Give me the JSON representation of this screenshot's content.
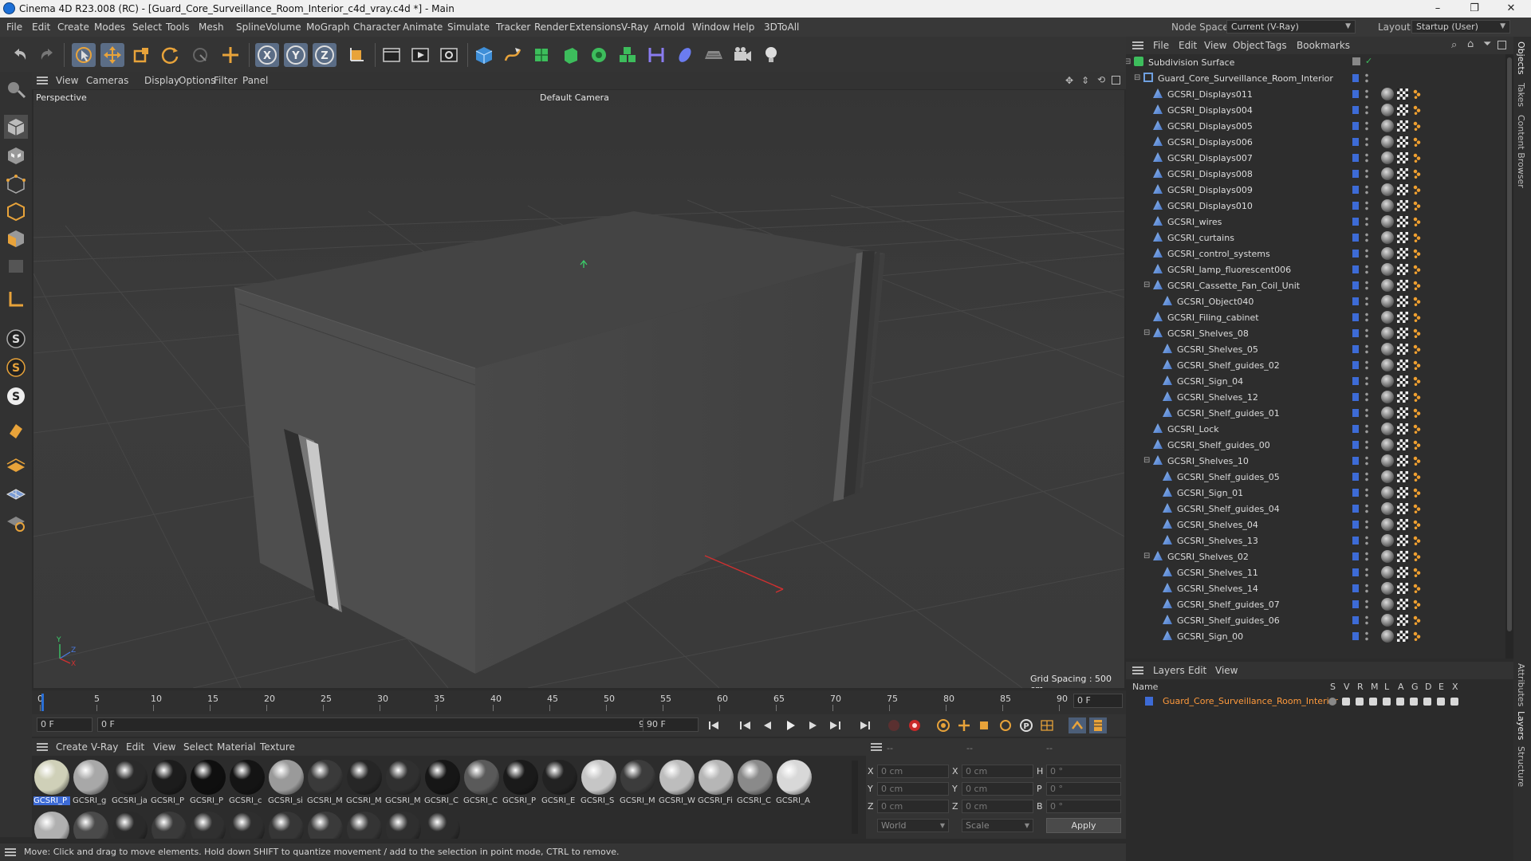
{
  "titlebar": {
    "title": "Cinema 4D R23.008 (RC) - [Guard_Core_Surveillance_Room_Interior_c4d_vray.c4d *] - Main",
    "minimize": "–",
    "maximize": "❐",
    "close": "✕"
  },
  "menu": [
    "File",
    "Edit",
    "Create",
    "Modes",
    "Select",
    "Tools",
    "Mesh",
    "Spline",
    "Volume",
    "MoGraph",
    "Character",
    "Animate",
    "Simulate",
    "Tracker",
    "Render",
    "Extensions",
    "V-Ray",
    "Arnold",
    "Window",
    "Help",
    "3DToAll"
  ],
  "nodespace": {
    "label": "Node Space:",
    "value": "Current (V-Ray)"
  },
  "layout": {
    "label": "Layout:",
    "value": "Startup (User)"
  },
  "viewport": {
    "menu": [
      "View",
      "Cameras",
      "Display",
      "Options",
      "Filter",
      "Panel"
    ],
    "name": "Perspective",
    "camera": "Default Camera",
    "grid_spacing": "Grid Spacing : 500 cm",
    "axis_y": "Y",
    "axis_z": "Z",
    "axis_x": "X"
  },
  "timeline": {
    "ticks": [
      "0",
      "5",
      "10",
      "15",
      "20",
      "25",
      "30",
      "35",
      "40",
      "45",
      "50",
      "55",
      "60",
      "65",
      "70",
      "75",
      "80",
      "85",
      "90"
    ],
    "current_frame": "0 F",
    "start": "0 F",
    "range_start": "0 F",
    "range_end": "90 F",
    "end": "90 F"
  },
  "materials": {
    "menu": [
      "Create",
      "V-Ray",
      "Edit",
      "View",
      "Select",
      "Material",
      "Texture"
    ],
    "row1": [
      {
        "label": "GCSRI_P",
        "color": "#cfd0b8",
        "selected": true
      },
      {
        "label": "GCSRI_g",
        "color": "#a8a8a8"
      },
      {
        "label": "GCSRI_ja",
        "color": "#2a2a2a"
      },
      {
        "label": "GCSRI_P",
        "color": "#1c1c1c"
      },
      {
        "label": "GCSRI_P",
        "color": "#0f0f0f"
      },
      {
        "label": "GCSRI_c",
        "color": "#141414"
      },
      {
        "label": "GCSRI_si",
        "color": "#9a9a9a"
      },
      {
        "label": "GCSRI_M",
        "color": "#3a3a3a"
      },
      {
        "label": "GCSRI_M",
        "color": "#262626"
      },
      {
        "label": "GCSRI_M",
        "color": "#303030"
      },
      {
        "label": "GCSRI_C",
        "color": "#161616"
      },
      {
        "label": "GCSRI_C",
        "color": "#5a5a5a"
      },
      {
        "label": "GCSRI_P",
        "color": "#1a1a1a"
      },
      {
        "label": "GCSRI_E",
        "color": "#222222"
      },
      {
        "label": "GCSRI_S",
        "color": "#c6c6c6"
      },
      {
        "label": "GCSRI_M",
        "color": "#3c3c3c"
      },
      {
        "label": "GCSRI_W",
        "color": "#bdbdbd"
      },
      {
        "label": "GCSRI_Fi",
        "color": "#b6b6b6"
      },
      {
        "label": "GCSRI_C",
        "color": "#8a8a8a"
      },
      {
        "label": "GCSRI_A",
        "color": "#d8d8d8"
      }
    ],
    "row2_colors": [
      "#b0b0b0",
      "#4a4a4a",
      "#2a2a2a",
      "#3a3a3a",
      "#303030",
      "#2e2e2e",
      "#363636",
      "#3a3a3a",
      "#343434",
      "#2f2f2f",
      "#2c2c2c"
    ]
  },
  "coords": {
    "header": [
      "--",
      "--",
      "--"
    ],
    "x": "0 cm",
    "y": "0 cm",
    "z": "0 cm",
    "x2": "0 cm",
    "y2": "0 cm",
    "z2": "0 cm",
    "h": "0 °",
    "p": "0 °",
    "b": "0 °",
    "lx": "X",
    "ly": "Y",
    "lz": "Z",
    "lx2": "X",
    "ly2": "Y",
    "lz2": "Z",
    "lh": "H",
    "lp": "P",
    "lb": "B",
    "mode1": "World",
    "mode2": "Scale",
    "apply": "Apply"
  },
  "status": "Move: Click and drag to move elements. Hold down SHIFT to quantize movement / add to the selection in point mode, CTRL to remove.",
  "objects": {
    "menu": [
      "File",
      "Edit",
      "View",
      "Object",
      "Tags",
      "Bookmarks"
    ],
    "items": [
      {
        "name": "Subdivision Surface",
        "indent": 0,
        "type": "subd"
      },
      {
        "name": "Guard_Core_Surveillance_Room_Interior",
        "indent": 1,
        "type": "null"
      },
      {
        "name": "GCSRI_Displays011",
        "indent": 2,
        "type": "poly"
      },
      {
        "name": "GCSRI_Displays004",
        "indent": 2,
        "type": "poly"
      },
      {
        "name": "GCSRI_Displays005",
        "indent": 2,
        "type": "poly"
      },
      {
        "name": "GCSRI_Displays006",
        "indent": 2,
        "type": "poly"
      },
      {
        "name": "GCSRI_Displays007",
        "indent": 2,
        "type": "poly"
      },
      {
        "name": "GCSRI_Displays008",
        "indent": 2,
        "type": "poly"
      },
      {
        "name": "GCSRI_Displays009",
        "indent": 2,
        "type": "poly"
      },
      {
        "name": "GCSRI_Displays010",
        "indent": 2,
        "type": "poly"
      },
      {
        "name": "GCSRI_wires",
        "indent": 2,
        "type": "poly"
      },
      {
        "name": "GCSRI_curtains",
        "indent": 2,
        "type": "poly"
      },
      {
        "name": "GCSRI_control_systems",
        "indent": 2,
        "type": "poly"
      },
      {
        "name": "GCSRI_lamp_fluorescent006",
        "indent": 2,
        "type": "poly"
      },
      {
        "name": "GCSRI_Cassette_Fan_Coil_Unit",
        "indent": 2,
        "type": "poly"
      },
      {
        "name": "GCSRI_Object040",
        "indent": 3,
        "type": "poly"
      },
      {
        "name": "GCSRI_Filing_cabinet",
        "indent": 2,
        "type": "poly"
      },
      {
        "name": "GCSRI_Shelves_08",
        "indent": 2,
        "type": "poly"
      },
      {
        "name": "GCSRI_Shelves_05",
        "indent": 3,
        "type": "poly"
      },
      {
        "name": "GCSRI_Shelf_guides_02",
        "indent": 3,
        "type": "poly"
      },
      {
        "name": "GCSRI_Sign_04",
        "indent": 3,
        "type": "poly"
      },
      {
        "name": "GCSRI_Shelves_12",
        "indent": 3,
        "type": "poly"
      },
      {
        "name": "GCSRI_Shelf_guides_01",
        "indent": 3,
        "type": "poly"
      },
      {
        "name": "GCSRI_Lock",
        "indent": 2,
        "type": "poly"
      },
      {
        "name": "GCSRI_Shelf_guides_00",
        "indent": 2,
        "type": "poly"
      },
      {
        "name": "GCSRI_Shelves_10",
        "indent": 2,
        "type": "poly"
      },
      {
        "name": "GCSRI_Shelf_guides_05",
        "indent": 3,
        "type": "poly"
      },
      {
        "name": "GCSRI_Sign_01",
        "indent": 3,
        "type": "poly"
      },
      {
        "name": "GCSRI_Shelf_guides_04",
        "indent": 3,
        "type": "poly"
      },
      {
        "name": "GCSRI_Shelves_04",
        "indent": 3,
        "type": "poly"
      },
      {
        "name": "GCSRI_Shelves_13",
        "indent": 3,
        "type": "poly"
      },
      {
        "name": "GCSRI_Shelves_02",
        "indent": 2,
        "type": "poly"
      },
      {
        "name": "GCSRI_Shelves_11",
        "indent": 3,
        "type": "poly"
      },
      {
        "name": "GCSRI_Shelves_14",
        "indent": 3,
        "type": "poly"
      },
      {
        "name": "GCSRI_Shelf_guides_07",
        "indent": 3,
        "type": "poly"
      },
      {
        "name": "GCSRI_Shelf_guides_06",
        "indent": 3,
        "type": "poly"
      },
      {
        "name": "GCSRI_Sign_00",
        "indent": 3,
        "type": "poly"
      }
    ]
  },
  "layers": {
    "menu": [
      "Layers",
      "Edit",
      "View"
    ],
    "col_name": "Name",
    "cols": [
      "S",
      "V",
      "R",
      "M",
      "L",
      "A",
      "G",
      "D",
      "E",
      "X"
    ],
    "row": "Guard_Core_Surveillance_Room_Interior"
  },
  "right_tabs": [
    "Objects",
    "Takes",
    "Content Browser",
    "Attributes",
    "Layers",
    "Structure"
  ],
  "colors": {
    "accent": "#3d6bd6",
    "selection": "#f0a030",
    "layer_text": "#ff9a3c"
  }
}
